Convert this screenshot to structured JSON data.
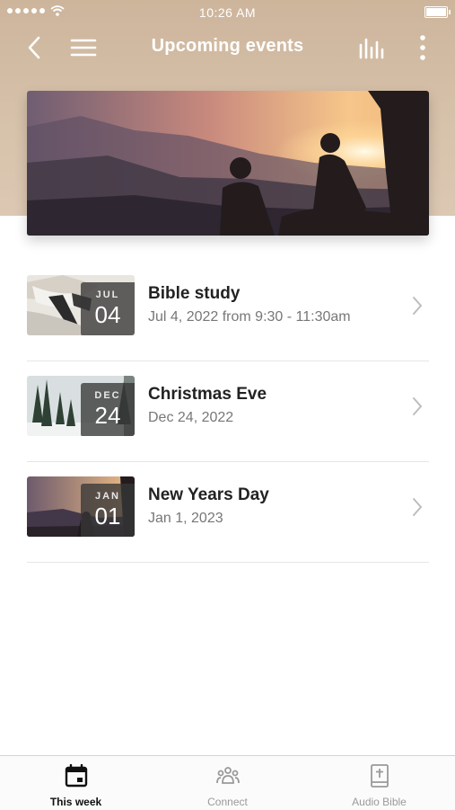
{
  "status_bar": {
    "time": "10:26 AM"
  },
  "nav": {
    "title": "Upcoming events",
    "back_icon": "chevron-left-icon",
    "menu_icon": "hamburger-menu-icon",
    "stats_icon": "bar-chart-icon",
    "more_icon": "vertical-ellipsis-icon"
  },
  "events": [
    {
      "month": "JUL",
      "day": "04",
      "title": "Bible study",
      "subtitle": "Jul 4, 2022 from 9:30 - 11:30am"
    },
    {
      "month": "DEC",
      "day": "24",
      "title": "Christmas Eve",
      "subtitle": "Dec 24, 2022"
    },
    {
      "month": "JAN",
      "day": "01",
      "title": "New Years Day",
      "subtitle": "Jan 1, 2023"
    }
  ],
  "tabs": [
    {
      "label": "This week",
      "icon": "calendar-icon",
      "active": true
    },
    {
      "label": "Connect",
      "icon": "people-group-icon",
      "active": false
    },
    {
      "label": "Audio Bible",
      "icon": "bible-icon",
      "active": false
    }
  ],
  "colors": {
    "header_tan": "#d3bca4",
    "active_tab": "#111111",
    "inactive_tab": "#9a9a9a"
  }
}
